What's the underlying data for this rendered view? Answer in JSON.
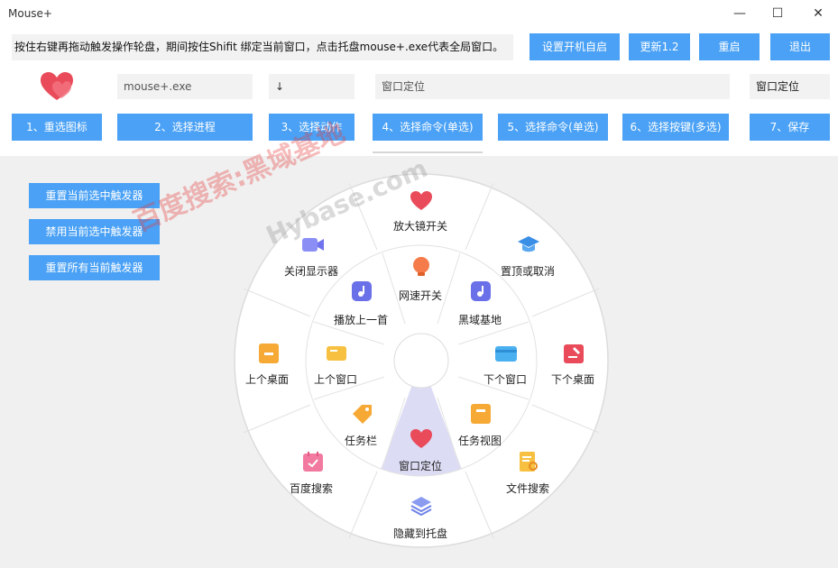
{
  "window": {
    "title": "Mouse+"
  },
  "info": {
    "text": "按住右键再拖动触发操作轮盘，期间按住Shifit 绑定当前窗口，点击托盘mouse+.exe代表全局窗口。"
  },
  "top_buttons": {
    "autostart": "设置开机自启",
    "update": "更新1.2",
    "restart": "重启",
    "exit": "退出"
  },
  "fields": {
    "process": "mouse+.exe",
    "action": "↓",
    "command": "窗口定位",
    "key": "窗口定位"
  },
  "steps": [
    "1、重选图标",
    "2、选择进程",
    "3、选择动作",
    "4、选择命令(单选)",
    "5、选择命令(单选)",
    "6、选择按键(多选)",
    "7、保存"
  ],
  "side_buttons": [
    "重置当前选中触发器",
    "禁用当前选中触发器",
    "重置所有当前触发器"
  ],
  "wheel": {
    "outer": [
      "放大镜开关",
      "置顶或取消",
      "下个桌面",
      "文件搜索",
      "隐藏到托盘",
      "百度搜索",
      "上个桌面",
      "关闭显示器"
    ],
    "inner": [
      "网速开关",
      "黑域基地",
      "下个窗口",
      "任务视图",
      "窗口定位",
      "任务栏",
      "上个窗口",
      "播放上一首"
    ]
  },
  "watermark": {
    "line1": "百度搜索:黑域基地",
    "line2": "Hybase.com"
  },
  "colors": {
    "accent": "#4aa1f5",
    "highlight": "#dcdcf5"
  }
}
